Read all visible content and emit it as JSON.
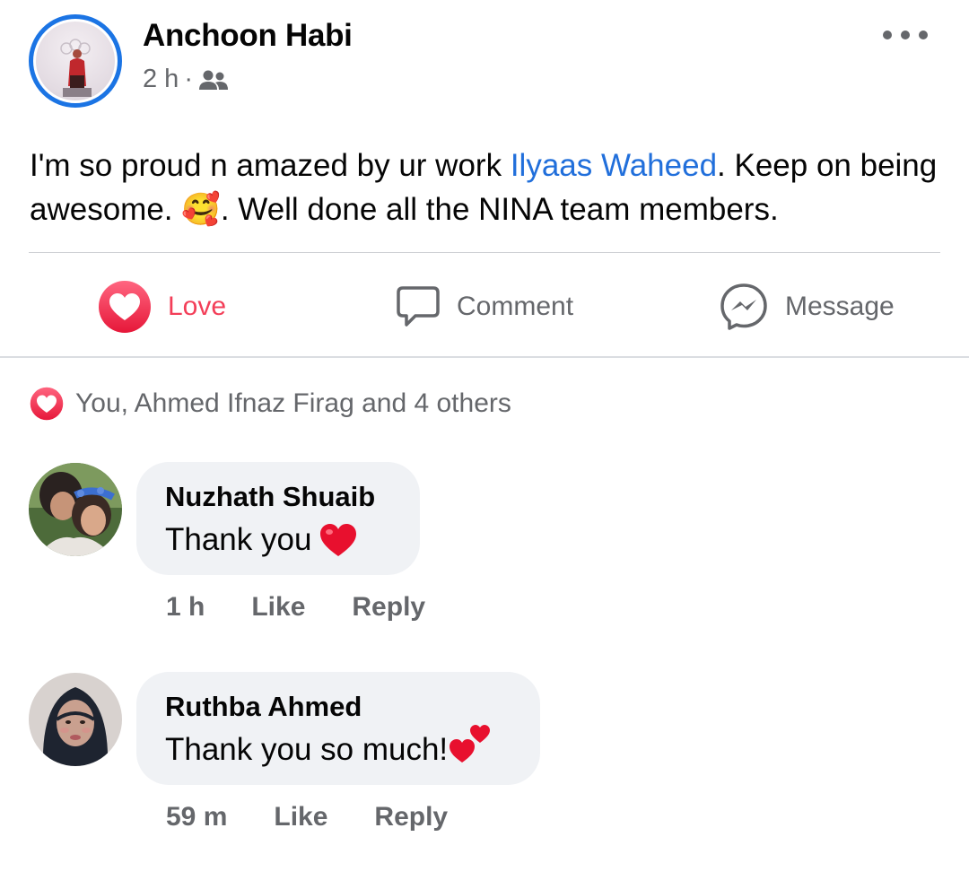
{
  "post": {
    "author": "Anchoon Habi",
    "time": "2 h",
    "separator": "·",
    "audience_icon": "friends-icon",
    "text_part1": "I'm so proud n amazed by ur work ",
    "mention": "Ilyaas Waheed",
    "text_part2": ". Keep on being awesome. ",
    "emoji": "🥰",
    "text_part3": ". Well done all the NINA team members."
  },
  "actions": {
    "love_label": "Love",
    "comment_label": "Comment",
    "message_label": "Message"
  },
  "reactions": {
    "summary": "You, Ahmed Ifnaz Firag and 4 others"
  },
  "comments": [
    {
      "name": "Nuzhath Shuaib",
      "text": "Thank you",
      "emoji": "❤️",
      "time": "1 h",
      "like_label": "Like",
      "reply_label": "Reply"
    },
    {
      "name": "Ruthba Ahmed",
      "text": "Thank you so much!",
      "emoji": "💕",
      "time": "59 m",
      "like_label": "Like",
      "reply_label": "Reply"
    }
  ],
  "colors": {
    "brand_blue": "#1b74e4",
    "love_red": "#f33e58",
    "mention_blue": "#216fdb",
    "secondary_text": "#65676b",
    "bubble_bg": "#f0f2f5"
  }
}
